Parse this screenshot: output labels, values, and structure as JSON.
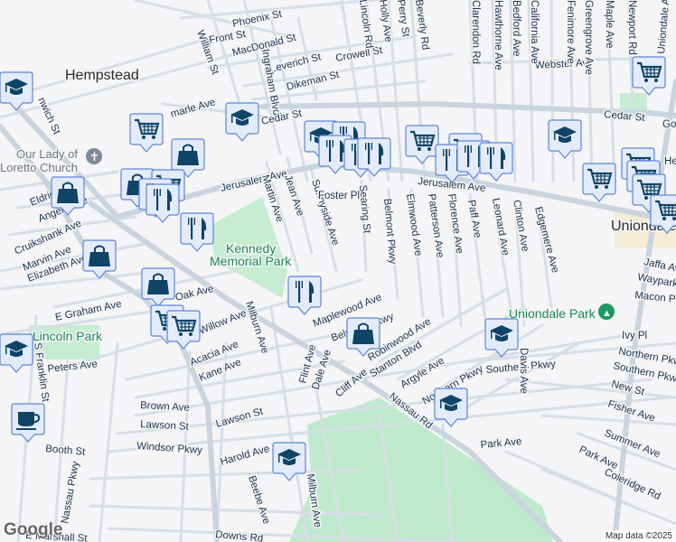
{
  "colors": {
    "background": "#f5f4f6",
    "road": "#d6dee6",
    "park": "#bfe9cc",
    "marker_fill": "#e3ebfb",
    "marker_border": "#5b86d8",
    "marker_icon": "#0e4466"
  },
  "places": {
    "hempstead": "Hempstead",
    "uniondale": "Uniondale",
    "church": [
      "Our Lady of",
      "Loretto Church"
    ],
    "kennedy_park": [
      "Kennedy",
      "Memorial Park"
    ],
    "uniondale_park": "Uniondale Park",
    "lincoln_park": "Lincoln Park"
  },
  "streets": [
    "Front St",
    "Phoenix St",
    "MacDonald St",
    "Leverich St",
    "Crowell St",
    "Webster Ave",
    "Dikeman St",
    "William St",
    "Ingraham Blvd",
    "Cedar St",
    "Cedar St",
    "marle Ave",
    "Jerusalem Ave",
    "Jerusalem Ave",
    "Martin Ave",
    "Jean Ave",
    "Sunnyside Ave",
    "Foster Pl",
    "Searing St",
    "Belmont Pkwy",
    "Elmwood Ave",
    "Patterson Ave",
    "Florence Ave",
    "Paff Ave",
    "Leonard Ave",
    "Clinton Ave",
    "Edgemere Ave",
    "Macon Pl",
    "Waypark",
    "Jaffa Av",
    "Ivy Pl",
    "Northern Pkwy",
    "Southern Pkwy",
    "Southern Pkwy",
    "New St",
    "Fisher Ave",
    "Summer Ave",
    "Park Ave",
    "Park Ave",
    "Coleridge Rd",
    "Peters Ave",
    "S Franklin St",
    "Brown Ave",
    "Lawson St",
    "Lawson St",
    "Windsor Pkwy",
    "Booth St",
    "Harold Ave",
    "Beebe Ave",
    "Milburn Ave",
    "Milburn Ave",
    "Downs Rd",
    "E Marshall St",
    "Nassau Pkwy",
    "Kane Ave",
    "Acacia Ave",
    "Willow Ave",
    "Oak Ave",
    "E Graham Ave",
    "Elizabeth Ave",
    "Marvin Ave",
    "Cruikshank Ave",
    "Angelo Ave",
    "Eldridge",
    "Maplewood Ave",
    "Belmont Pkwy",
    "Robinwood Ave",
    "Stanton Blvd",
    "Argyle Ave",
    "Northern Pkwy",
    "Flint Ave",
    "Dale Ave",
    "Cliff Ave",
    "Nassau Rd",
    "nwich St",
    "Lincoln Rd",
    "Holly Ave",
    "Perry St",
    "Beverly Rd",
    "Clarendon Rd",
    "Hawthorne Ave",
    "Bedford Ave",
    "California Ave",
    "Fenimore Ave",
    "Greengrove Ave",
    "Maple Ave",
    "Newport Rd",
    "Uniondale Ave",
    "Hempstead Blvd",
    "Davis Ave",
    "Goodrich St"
  ],
  "markers": [
    "school",
    "cart",
    "school",
    "bag",
    "bag",
    "cart",
    "food",
    "food",
    "bag",
    "food",
    "bag",
    "bag",
    "cart",
    "cart",
    "food",
    "school",
    "coffee",
    "school",
    "bag",
    "school",
    "school",
    "school",
    "food",
    "food",
    "food",
    "food",
    "cart",
    "cart",
    "food",
    "food",
    "food",
    "school",
    "cart",
    "cart",
    "cart",
    "cart",
    "cart",
    "cart"
  ],
  "footer": {
    "logo": "Google",
    "attribution": "Map data ©2025"
  }
}
